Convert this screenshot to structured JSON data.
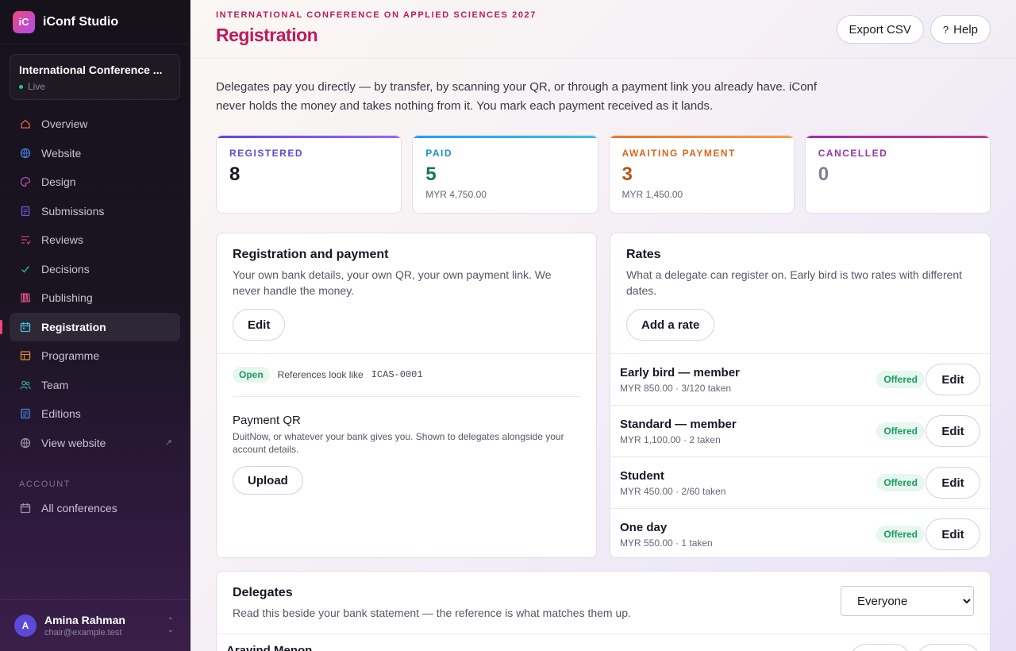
{
  "app": {
    "logo_text": "iC",
    "name": "iConf Studio"
  },
  "conference": {
    "name": "International Conference ...",
    "status": "Live"
  },
  "sidebar": {
    "items": [
      {
        "label": "Overview",
        "icon": "home-icon"
      },
      {
        "label": "Website",
        "icon": "globe-icon"
      },
      {
        "label": "Design",
        "icon": "palette-icon"
      },
      {
        "label": "Submissions",
        "icon": "document-icon"
      },
      {
        "label": "Reviews",
        "icon": "review-icon"
      },
      {
        "label": "Decisions",
        "icon": "check-icon"
      },
      {
        "label": "Publishing",
        "icon": "books-icon"
      },
      {
        "label": "Registration",
        "icon": "calendar-icon",
        "active": true
      },
      {
        "label": "Programme",
        "icon": "table-icon"
      },
      {
        "label": "Team",
        "icon": "people-icon"
      },
      {
        "label": "Editions",
        "icon": "list-icon"
      },
      {
        "label": "View website",
        "icon": "globe-icon",
        "external": true
      }
    ],
    "account_label": "ACCOUNT",
    "account_items": [
      {
        "label": "All conferences",
        "icon": "calendar-icon"
      }
    ]
  },
  "user": {
    "initial": "A",
    "name": "Amina Rahman",
    "email": "chair@example.test"
  },
  "header": {
    "eyebrow": "INTERNATIONAL CONFERENCE ON APPLIED SCIENCES 2027",
    "title": "Registration",
    "export_label": "Export CSV",
    "help_label": "Help"
  },
  "intro": "Delegates pay you directly — by transfer, by scanning your QR, or through a payment link you already have. iConf never holds the money and takes nothing from it. You mark each payment received as it lands.",
  "stats": [
    {
      "label": "REGISTERED",
      "value": "8",
      "sub": "",
      "color": "#5b4ad9",
      "value_color": "#1a1625"
    },
    {
      "label": "PAID",
      "value": "5",
      "sub": "MYR 4,750.00",
      "color": "#1f8fc4",
      "value_color": "#0f7a52"
    },
    {
      "label": "AWAITING PAYMENT",
      "value": "3",
      "sub": "MYR 1,450.00",
      "color": "#d8691f",
      "value_color": "#b8541a"
    },
    {
      "label": "CANCELLED",
      "value": "0",
      "sub": "",
      "color": "#9b2fb0",
      "value_color": "#857d92"
    }
  ],
  "payment_card": {
    "title": "Registration and payment",
    "desc": "Your own bank details, your own QR, your own payment link. We never handle the money.",
    "edit_label": "Edit",
    "status_badge": "Open",
    "ref_prefix": "References look like",
    "ref_example": "ICAS-0001",
    "qr_title": "Payment QR",
    "qr_desc": "DuitNow, or whatever your bank gives you. Shown to delegates alongside your account details.",
    "upload_label": "Upload"
  },
  "rates_card": {
    "title": "Rates",
    "desc": "What a delegate can register on. Early bird is two rates with different dates.",
    "add_label": "Add a rate",
    "rows": [
      {
        "name": "Early bird — member",
        "meta": "MYR 850.00 · 3/120 taken",
        "badge": "Offered",
        "edit": "Edit"
      },
      {
        "name": "Standard — member",
        "meta": "MYR 1,100.00 · 2 taken",
        "badge": "Offered",
        "edit": "Edit"
      },
      {
        "name": "Student",
        "meta": "MYR 450.00 · 2/60 taken",
        "badge": "Offered",
        "edit": "Edit"
      },
      {
        "name": "One day",
        "meta": "MYR 550.00 · 1 taken",
        "badge": "Offered",
        "edit": "Edit"
      }
    ]
  },
  "delegates_card": {
    "title": "Delegates",
    "desc": "Read this beside your bank statement — the reference is what matches them up.",
    "filter_selected": "Everyone",
    "first_row_name": "Aravind Menon"
  }
}
